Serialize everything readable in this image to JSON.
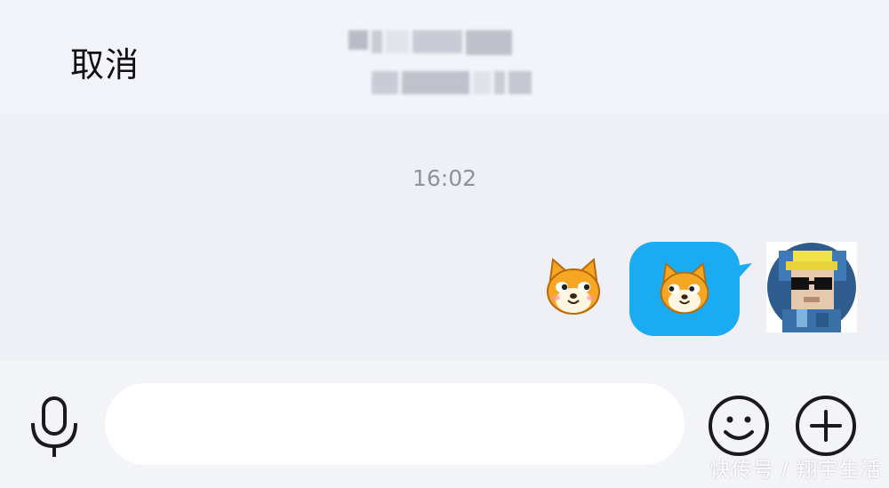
{
  "header": {
    "cancel_label": "取消"
  },
  "chat": {
    "timestamp": "16:02",
    "messages": [
      {
        "from": "self",
        "kind": "sticker",
        "sticker": "shiba-dog-sticker"
      },
      {
        "from": "self",
        "kind": "bubble-sticker",
        "sticker": "shiba-dog-sticker",
        "bubble_color": "#1aabf2"
      }
    ]
  },
  "input": {
    "value": "",
    "placeholder": ""
  },
  "icons": {
    "mic": "microphone-icon",
    "emoji": "emoji-smile-icon",
    "plus": "plus-icon"
  },
  "watermark": "快传号 / 翔宇生活",
  "colors": {
    "accent": "#1aabf2",
    "header_bg": "#f2f4f9",
    "chat_bg": "#eef0f6",
    "input_bar_bg": "#f3f4f8",
    "icon_stroke": "#1a1a1a"
  }
}
